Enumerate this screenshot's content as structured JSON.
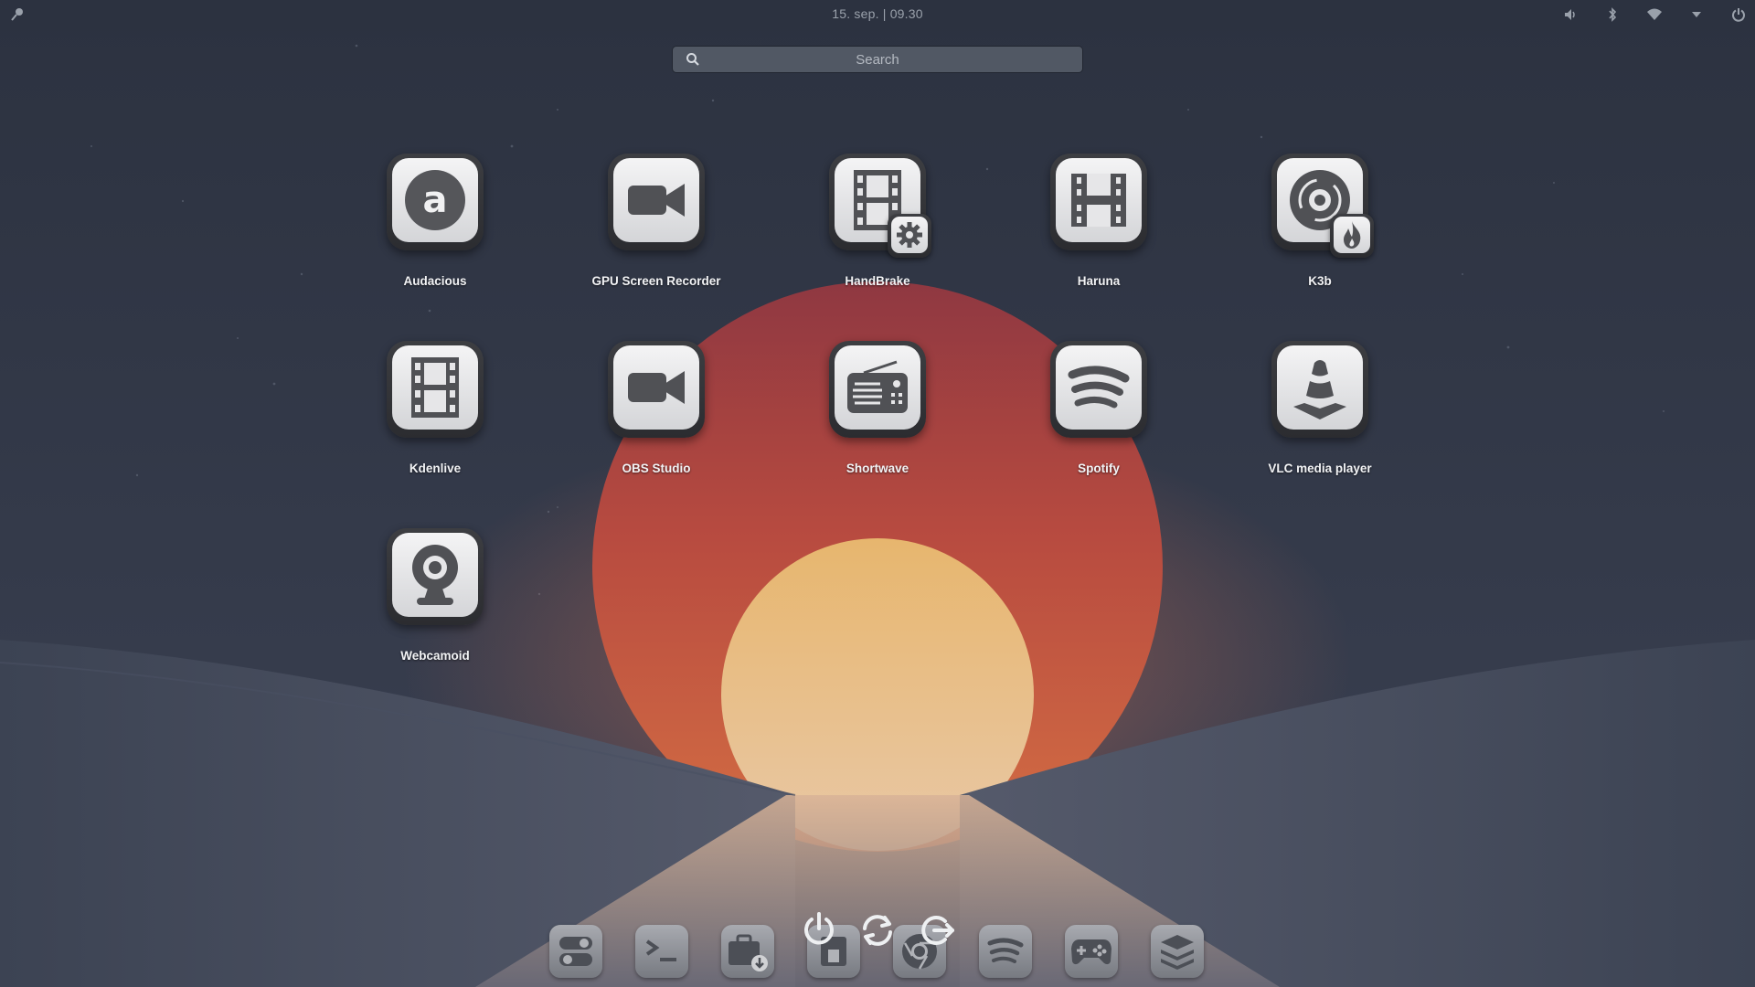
{
  "topbar": {
    "clock": "15. sep. | 09.30",
    "left_icon": "menu-pin-icon",
    "tray": [
      "volume-icon",
      "bluetooth-icon",
      "wifi-icon",
      "dropdown-arrow-icon",
      "power-icon"
    ]
  },
  "search": {
    "placeholder": "Search",
    "value": ""
  },
  "apps": [
    {
      "label": "Audacious",
      "icon": "audacious-icon"
    },
    {
      "label": "GPU Screen Recorder",
      "icon": "video-camera-icon"
    },
    {
      "label": "HandBrake",
      "icon": "film-gear-icon"
    },
    {
      "label": "Haruna",
      "icon": "haruna-film-icon"
    },
    {
      "label": "K3b",
      "icon": "disc-burn-icon"
    },
    {
      "label": "Kdenlive",
      "icon": "film-strip-icon"
    },
    {
      "label": "OBS Studio",
      "icon": "video-camera-icon"
    },
    {
      "label": "Shortwave",
      "icon": "radio-icon"
    },
    {
      "label": "Spotify",
      "icon": "spotify-icon"
    },
    {
      "label": "VLC media player",
      "icon": "traffic-cone-icon"
    },
    {
      "label": "Webcamoid",
      "icon": "webcam-icon"
    }
  ],
  "session_buttons": [
    "power-icon",
    "restart-icon",
    "logout-icon"
  ],
  "dock": [
    "settings-toggle-icon",
    "terminal-icon",
    "software-store-icon",
    "files-icon",
    "chrome-icon",
    "spotify-icon",
    "gamepad-icon",
    "layers-icon"
  ],
  "colors": {
    "background": "#2f3645",
    "sun_outer": "#c2533f",
    "sun_inner": "#e6b475",
    "tile_face": "#f4f4f5",
    "label": "#f2f3f5"
  }
}
